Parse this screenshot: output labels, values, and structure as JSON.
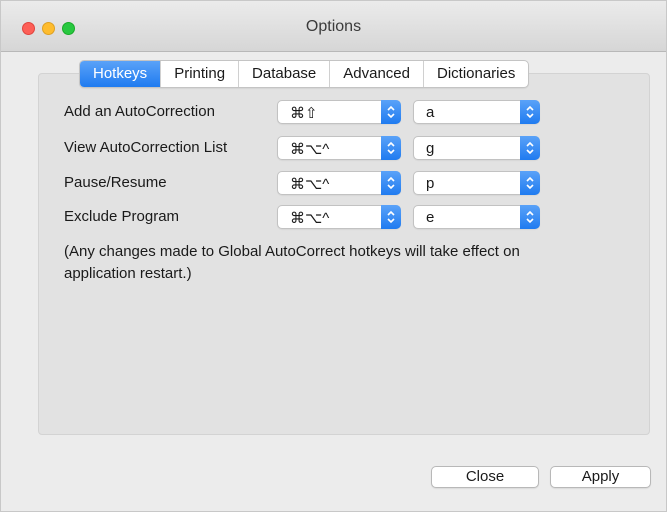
{
  "window": {
    "title": "Options",
    "traffic_lights": {
      "close": "#fd5f57",
      "minimize": "#febc2e",
      "zoom": "#28c840"
    }
  },
  "tabs": [
    {
      "label": "Hotkeys",
      "active": true
    },
    {
      "label": "Printing",
      "active": false
    },
    {
      "label": "Database",
      "active": false
    },
    {
      "label": "Advanced",
      "active": false
    },
    {
      "label": "Dictionaries",
      "active": false
    }
  ],
  "hotkeys": [
    {
      "label": "Add an AutoCorrection",
      "modifiers": "⌘⇧",
      "key": "a"
    },
    {
      "label": "View AutoCorrection List",
      "modifiers": "⌘⌥^",
      "key": "g"
    },
    {
      "label": "Pause/Resume",
      "modifiers": "⌘⌥^",
      "key": "p"
    },
    {
      "label": "Exclude Program",
      "modifiers": "⌘⌥^",
      "key": "e"
    }
  ],
  "note": "(Any changes made to Global AutoCorrect hotkeys will take effect on application restart.)",
  "buttons": {
    "close": "Close",
    "apply": "Apply"
  },
  "colors": {
    "accent": "#1f7bf0",
    "panel": "#e2e2e2",
    "window": "#ececec"
  }
}
